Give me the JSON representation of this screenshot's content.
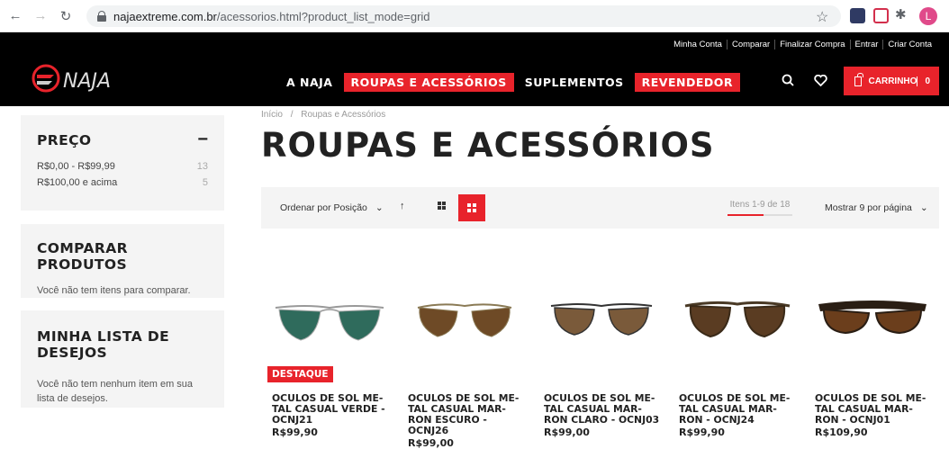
{
  "browser": {
    "url_host": "najaextreme.com.br",
    "url_path": "/acessorios.html?product_list_mode=grid",
    "profile_initial": "L"
  },
  "header": {
    "top_links": [
      "Minha Conta",
      "Comparar",
      "Finalizar Compra",
      "Entrar",
      "Criar Conta"
    ],
    "nav": [
      {
        "label": "A NAJA",
        "highlight": false
      },
      {
        "label": "ROUPAS E ACESSÓRIOS",
        "highlight": true
      },
      {
        "label": "SUPLEMENTOS",
        "highlight": false
      },
      {
        "label": "REVENDEDOR",
        "highlight": true
      }
    ],
    "cart_label": "CARRINHO",
    "cart_count": "0"
  },
  "sidebar": {
    "price": {
      "title": "PREÇO",
      "toggle": "−",
      "options": [
        {
          "label": "R$0,00 - R$99,99",
          "count": "13"
        },
        {
          "label": "R$100,00 e acima",
          "count": "5"
        }
      ]
    },
    "compare": {
      "title": "COMPARAR PRODUTOS",
      "text": "Você não tem itens para comparar."
    },
    "wishlist": {
      "title": "MINHA LISTA DE DESEJOS",
      "text": "Você não tem nenhum item em sua lista de desejos."
    }
  },
  "main": {
    "breadcrumb": [
      "Início",
      "Roupas e Acessórios"
    ],
    "breadcrumb_sep": "/",
    "title": "ROUPAS E ACESSÓRIOS",
    "toolbar": {
      "sort_label": "Ordenar por Posição",
      "items_label": "Itens 1-9 de 18",
      "limiter_label": "Mostrar 9 por página"
    },
    "products": [
      {
        "name": "OCULOS DE SOL ME-TAL CASUAL VERDE - OCNJ21",
        "price": "R$99,90",
        "badge": "DESTAQUE"
      },
      {
        "name": "OCULOS DE SOL ME-TAL CASUAL MAR-RON ESCURO - OCNJ26",
        "price": "R$99,00",
        "badge": ""
      },
      {
        "name": "OCULOS DE SOL ME-TAL CASUAL MAR-RON CLARO - OCNJ03",
        "price": "R$99,00",
        "badge": ""
      },
      {
        "name": "OCULOS DE SOL ME-TAL CASUAL MAR-RON - OCNJ24",
        "price": "R$99,90",
        "badge": ""
      },
      {
        "name": "OCULOS DE SOL ME-TAL CASUAL MAR-RON - OCNJ01",
        "price": "R$109,90",
        "badge": ""
      }
    ]
  },
  "colors": {
    "accent": "#e8232b",
    "header_bg": "#000000",
    "panel_bg": "#f4f4f4"
  }
}
